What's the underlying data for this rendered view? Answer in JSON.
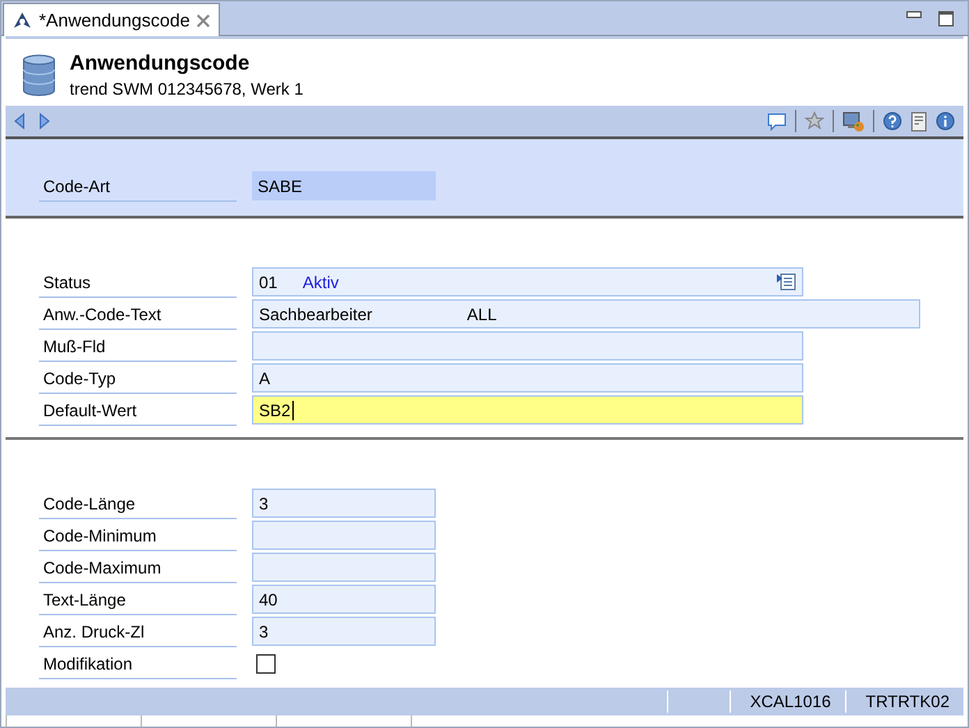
{
  "tab": {
    "title": "*Anwendungscode"
  },
  "header": {
    "title": "Anwendungscode",
    "subtitle": "trend SWM 012345678, Werk 1"
  },
  "key_section": {
    "fields": [
      {
        "label": "Code-Art",
        "value": "SABE"
      }
    ]
  },
  "main_section": {
    "fields": [
      {
        "label": "Status",
        "kind": "status",
        "code": "01",
        "text": "Aktiv",
        "focused": false
      },
      {
        "label": "Anw.-Code-Text",
        "kind": "pair",
        "value": "Sachbearbeiter",
        "extra": "ALL",
        "focused": false
      },
      {
        "label": "Muß-Fld",
        "kind": "text",
        "focused": false
      },
      {
        "label": "Code-Typ",
        "kind": "text",
        "value": "A",
        "focused": false
      },
      {
        "label": "Default-Wert",
        "kind": "text",
        "value": "SB2",
        "focused": true
      }
    ]
  },
  "detail_section": {
    "fields": [
      {
        "label": "Code-Länge",
        "kind": "text",
        "value": "3"
      },
      {
        "label": "Code-Minimum",
        "kind": "text"
      },
      {
        "label": "Code-Maximum",
        "kind": "text"
      },
      {
        "label": "Text-Länge",
        "kind": "text",
        "value": "40"
      },
      {
        "label": "Anz. Druck-Zl",
        "kind": "text",
        "value": "3"
      },
      {
        "label": "Modifikation",
        "kind": "checkbox",
        "checked": false
      }
    ]
  },
  "status_bar": {
    "fields": [
      "XCAL1016",
      "TRTRTK02"
    ]
  }
}
